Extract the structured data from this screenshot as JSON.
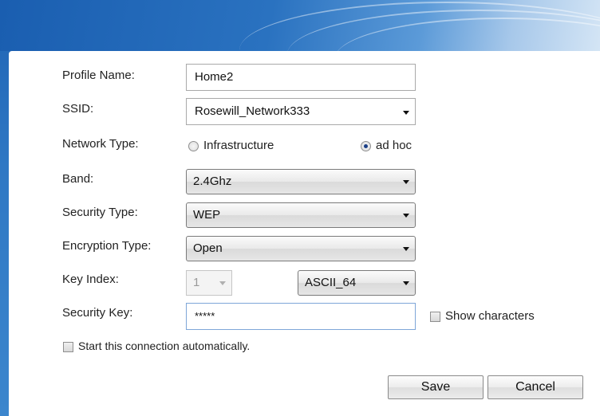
{
  "form": {
    "profile_name": {
      "label": "Profile Name:",
      "value": "Home2"
    },
    "ssid": {
      "label": "SSID:",
      "value": "Rosewill_Network333"
    },
    "network_type": {
      "label": "Network Type:",
      "options": [
        "Infrastructure",
        "ad hoc"
      ],
      "selected": "ad hoc"
    },
    "band": {
      "label": "Band:",
      "value": "2.4Ghz"
    },
    "security_type": {
      "label": "Security Type:",
      "value": "WEP"
    },
    "encryption_type": {
      "label": "Encryption Type:",
      "value": "Open"
    },
    "key_index": {
      "label": "Key Index:",
      "value": "1",
      "format": "ASCII_64"
    },
    "security_key": {
      "label": "Security Key:",
      "value": "*****",
      "show_label": "Show characters"
    },
    "auto_connect": {
      "label": "Start this connection automatically."
    }
  },
  "buttons": {
    "save": "Save",
    "cancel": "Cancel"
  },
  "colors": {
    "header_blue": "#2a72c0",
    "panel_bg": "#ffffff",
    "radio_dot": "#1b3f86"
  }
}
